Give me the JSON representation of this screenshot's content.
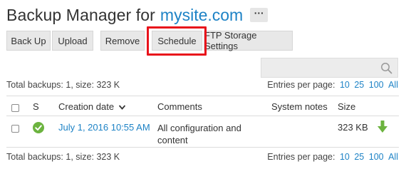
{
  "header": {
    "title": "Backup Manager for",
    "site": "mysite.com",
    "more_label": "···"
  },
  "toolbar": {
    "backup_label": "Back Up",
    "upload_label": "Upload",
    "remove_label": "Remove",
    "schedule_label": "Schedule",
    "ftp_label": "FTP Storage Settings"
  },
  "search": {
    "placeholder": "",
    "icon": "search-icon"
  },
  "summary": {
    "text": "Total backups: 1, size: 323 K",
    "entries_label": "Entries per page:",
    "entries_options": [
      "10",
      "25",
      "100",
      "All"
    ]
  },
  "table": {
    "headers": {
      "status": "S",
      "creation_date": "Creation date",
      "comments": "Comments",
      "system_notes": "System notes",
      "size": "Size"
    },
    "rows": [
      {
        "status_icon": "check-circle-icon",
        "status_color": "#6cb33f",
        "creation_date": "July 1, 2016 10:55 AM",
        "comments_line1": "All configuration and",
        "comments_line2": "content",
        "system_notes": "",
        "size": "323 KB",
        "download_icon": "download-arrow-icon",
        "download_color": "#6cb33f"
      }
    ]
  },
  "colors": {
    "link": "#1e83c6",
    "highlight": "#e8121b",
    "button_bg": "#e8e8e8"
  }
}
